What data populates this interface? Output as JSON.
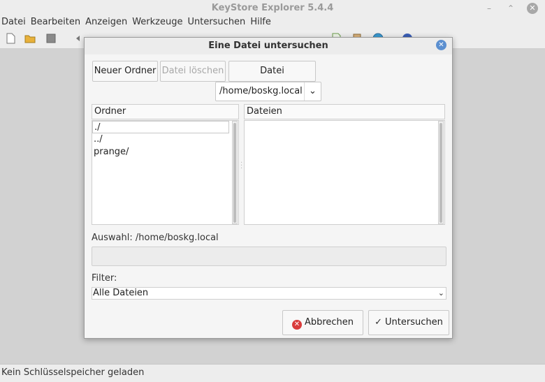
{
  "window": {
    "title": "KeyStore Explorer 5.4.4",
    "min_glyph": "–",
    "max_glyph": "⌃",
    "close_glyph": "✕"
  },
  "menu": [
    "Datei",
    "Bearbeiten",
    "Anzeigen",
    "Werkzeuge",
    "Untersuchen",
    "Hilfe"
  ],
  "toolbar_icons": [
    "new-icon",
    "open-icon",
    "save-icon",
    "undo-icon",
    "redo-icon",
    "cut-icon",
    "copy-icon",
    "paste-icon",
    "keypair-icon",
    "key-icon",
    "import-icon",
    "properties-icon",
    "examine-file-icon",
    "examine-clipboard-icon",
    "examine-ssl-icon",
    "help-icon"
  ],
  "dialog": {
    "title": "Eine Datei untersuchen",
    "close_glyph": "✕",
    "new_folder": "Neuer Ordner",
    "delete_file": "Datei löschen",
    "rename_file": "Datei umbenennen",
    "path": "/home/boskg.local",
    "path_arrow": "⌄",
    "folders_header": "Ordner",
    "files_header": "Dateien",
    "folders": [
      "./",
      "../",
      "prange/"
    ],
    "selection_label": "Auswahl: /home/boskg.local",
    "selection_value": "",
    "filter_label": "Filter:",
    "filter_value": "Alle Dateien",
    "filter_arrow": "⌄",
    "cancel": "Abbrechen",
    "cancel_glyph": "✕",
    "examine": "Untersuchen",
    "examine_glyph": "✓"
  },
  "status": "Kein Schlüsselspeicher geladen",
  "colors": {
    "dialog_close": "#5b8fd0",
    "cancel_icon": "#d93c3c"
  }
}
